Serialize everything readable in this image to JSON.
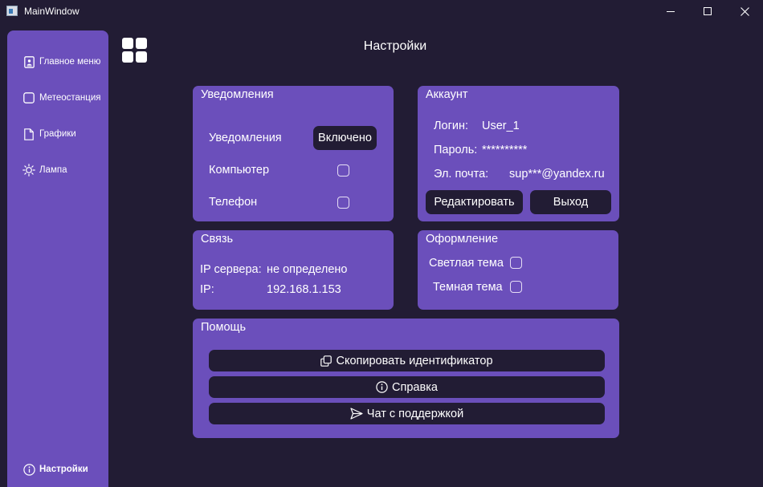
{
  "window": {
    "title": "MainWindow",
    "controls": [
      "minimize",
      "maximize",
      "close"
    ]
  },
  "sidebar": {
    "items": [
      {
        "label": "Главное меню",
        "icon": "home-icon"
      },
      {
        "label": "Метеостанция",
        "icon": "square-icon"
      },
      {
        "label": "Графики",
        "icon": "document-icon"
      },
      {
        "label": "Лампа",
        "icon": "sun-icon"
      }
    ],
    "bottom_item": {
      "label": "Настройки",
      "icon": "info-icon",
      "active": true
    }
  },
  "header": {
    "title": "Настройки",
    "menu_icon": "grid-icon"
  },
  "notifications": {
    "title": "Уведомления",
    "toggle_label": "Уведомления",
    "toggle_value": "Включено",
    "computer_label": "Компьютер",
    "computer_checked": false,
    "phone_label": "Телефон",
    "phone_checked": false
  },
  "account": {
    "title": "Аккаунт",
    "login_label": "Логин:",
    "login_value": "User_1",
    "password_label": "Пароль:",
    "password_value": "**********",
    "email_label": "Эл. почта:",
    "email_value": "sup***@yandex.ru",
    "edit_button": "Редактировать",
    "logout_button": "Выход"
  },
  "connection": {
    "title": "Связь",
    "server_label": "IP сервера:",
    "server_value": "не определено",
    "ip_label": "IP:",
    "ip_value": "192.168.1.153"
  },
  "appearance": {
    "title": "Оформление",
    "light_label": "Светлая тема",
    "light_checked": false,
    "dark_label": "Темная тема",
    "dark_checked": false
  },
  "help": {
    "title": "Помощь",
    "copy_button": "Скопировать идентификатор",
    "copy_icon": "copy-icon",
    "info_button": "Справка",
    "info_icon": "info-icon",
    "support_button": "Чат с поддержкой",
    "support_icon": "send-icon"
  },
  "colors": {
    "background": "#221c34",
    "panel": "#6b4fbb",
    "button_dark": "#221c34",
    "text": "#ffffff"
  }
}
